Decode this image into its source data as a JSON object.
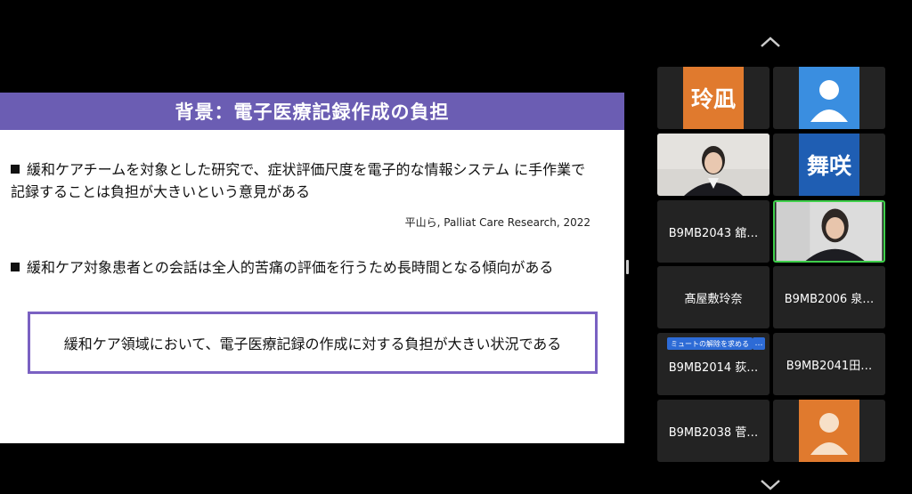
{
  "slide": {
    "title": "背景：電子医療記録作成の負担",
    "bullet1": "緩和ケアチームを対象とした研究で、症状評価尺度を電子的な情報システム に手作業で記録することは負担が大きいという意見がある",
    "citation": "平山ら, Palliat Care Research, 2022",
    "bullet2": "緩和ケア対象患者との会話は全人的苦痛の評価を行うため長時間となる傾向がある",
    "callout": "緩和ケア領域において、電子医療記録の作成に対する負担が大きい状況である"
  },
  "participants": [
    {
      "avatar_text": "玲凪",
      "color": "#e07a2e"
    },
    {
      "avatar_icon": "person-icon",
      "color": "#3a8ee0"
    },
    {
      "type": "video"
    },
    {
      "avatar_text": "舞咲",
      "color": "#1f5eb3"
    },
    {
      "name": "B9MB2043 舘…"
    },
    {
      "type": "video",
      "active": true
    },
    {
      "name": "髙屋敷玲奈"
    },
    {
      "name": "B9MB2006 泉…"
    },
    {
      "name": "B9MB2014 荻…",
      "badge": "ミュートの解除を求める",
      "more": "…"
    },
    {
      "name": "B9MB2041田…"
    },
    {
      "name": "B9MB2038 菅…"
    },
    {
      "avatar_icon": "person-icon",
      "color": "#e07a2e"
    }
  ]
}
